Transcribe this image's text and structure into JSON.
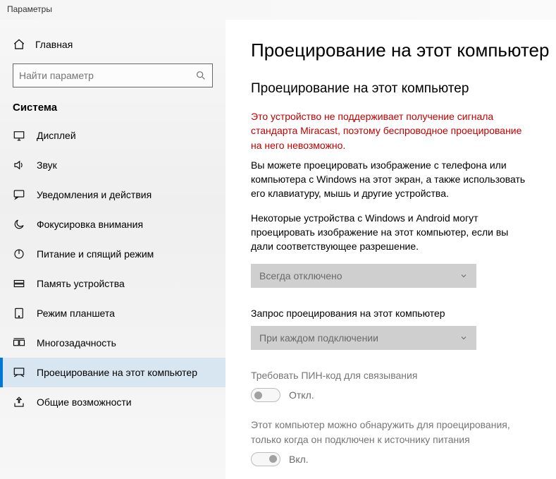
{
  "window": {
    "title": "Параметры"
  },
  "sidebar": {
    "home_label": "Главная",
    "section_label": "Система",
    "items": [
      {
        "label": "Дисплей"
      },
      {
        "label": "Звук"
      },
      {
        "label": "Уведомления и действия"
      },
      {
        "label": "Фокусировка внимания"
      },
      {
        "label": "Питание и спящий режим"
      },
      {
        "label": "Память устройства"
      },
      {
        "label": "Режим планшета"
      },
      {
        "label": "Многозадачность"
      },
      {
        "label": "Проецирование на этот компьютер"
      },
      {
        "label": "Общие возможности"
      }
    ]
  },
  "search": {
    "placeholder": "Найти параметр"
  },
  "page": {
    "title": "Проецирование на этот компьютер",
    "subtitle": "Проецирование на этот компьютер",
    "warning": "Это устройство не поддерживает получение сигнала стандарта Miracast, поэтому беспроводное проецирование на него невозможно.",
    "desc1": "Вы можете проецировать изображение с телефона или компьютера с Windows на этот экран, а также использовать его клавиатуру, мышь и другие устройства.",
    "desc2": "Некоторые устройства с Windows и Android могут проецировать изображение на этот компьютер, если вы дали соответствующее разрешение.",
    "dropdown1": {
      "value": "Всегда отключено"
    },
    "label2": "Запрос проецирования на этот компьютер",
    "dropdown2": {
      "value": "При каждом подключении"
    },
    "pin_label": "Требовать ПИН-код для связывания",
    "pin_state": "Откл.",
    "power_label": "Этот компьютер можно обнаружить для проецирования, только когда он подключен к источнику питания",
    "power_state": "Вкл."
  }
}
